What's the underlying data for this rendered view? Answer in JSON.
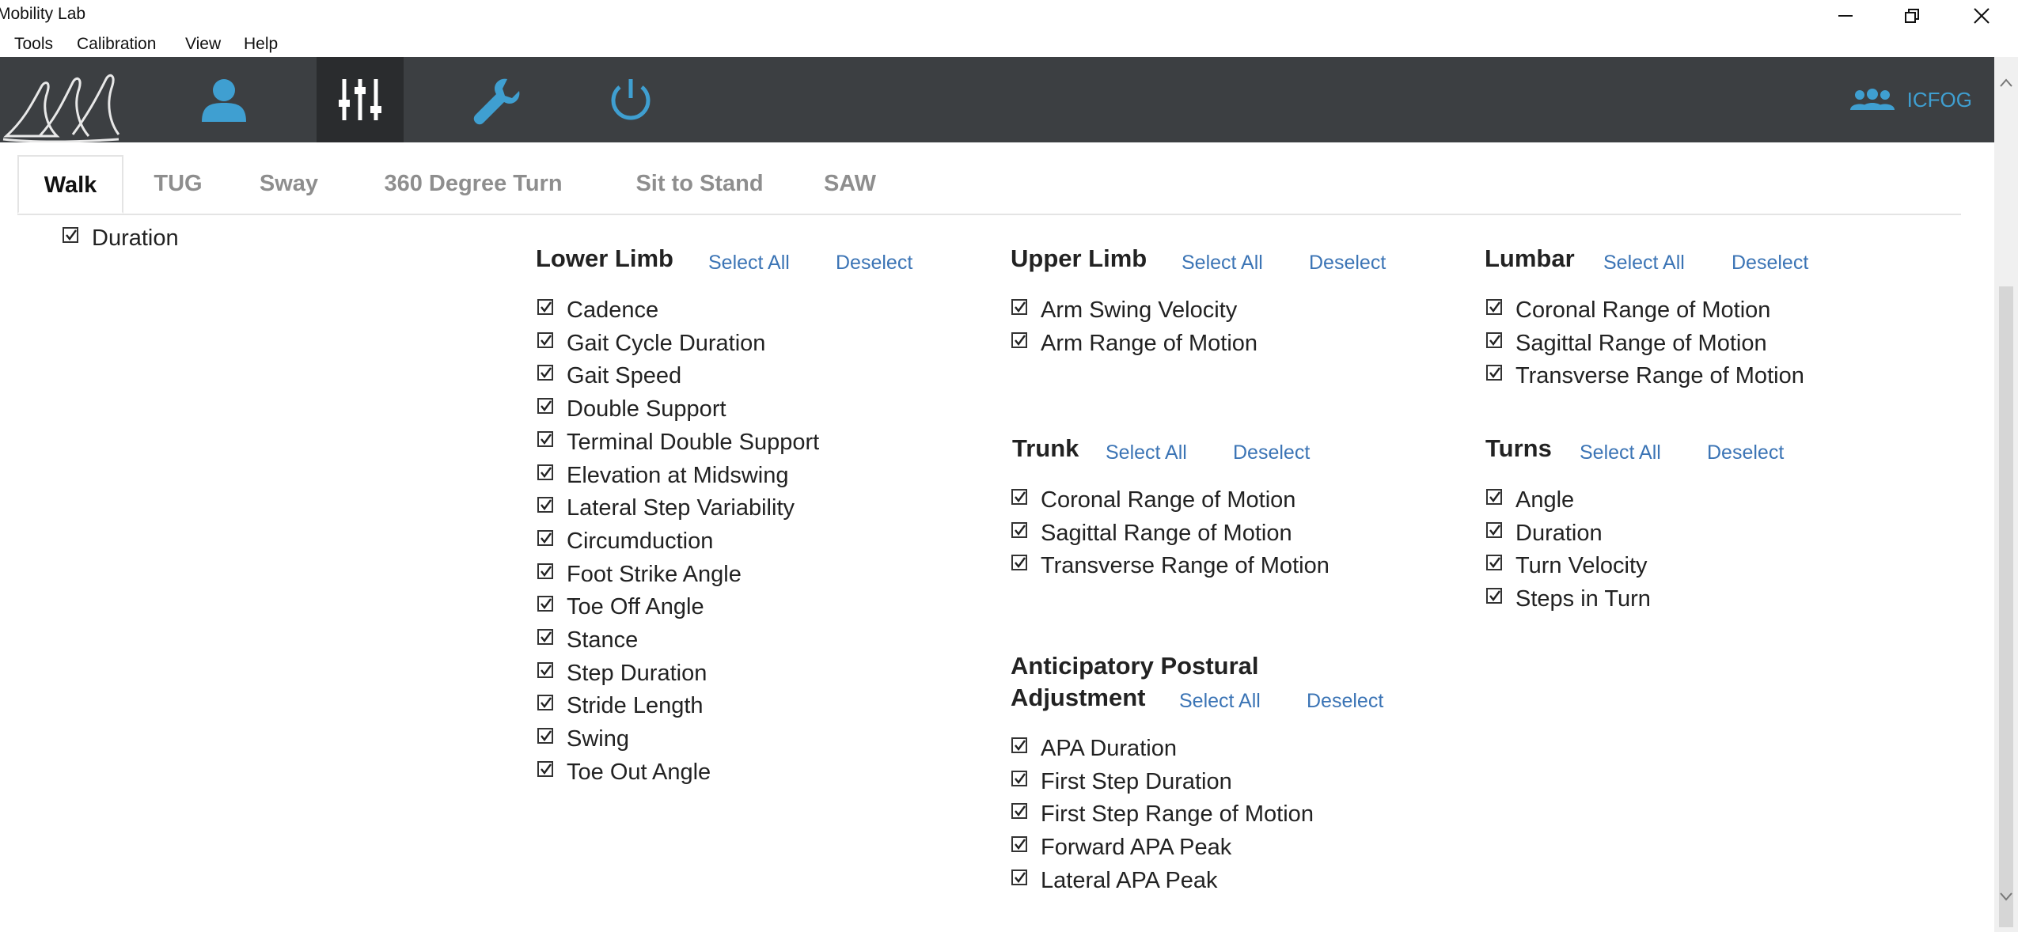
{
  "app": {
    "title": "Mobility Lab"
  },
  "menu": [
    "Tools",
    "Calibration",
    "View",
    "Help"
  ],
  "toolbar": {
    "user": "ICFOG"
  },
  "tabs": [
    "Walk",
    "TUG",
    "Sway",
    "360 Degree Turn",
    "Sit to Stand",
    "SAW"
  ],
  "duration_label": "Duration",
  "links": {
    "select_all": "Select All",
    "deselect": "Deselect"
  },
  "groups": {
    "lower_limb": {
      "title": "Lower Limb",
      "items": [
        "Cadence",
        "Gait Cycle Duration",
        "Gait Speed",
        "Double Support",
        "Terminal Double Support",
        "Elevation at Midswing",
        "Lateral Step Variability",
        "Circumduction",
        "Foot Strike Angle",
        "Toe Off Angle",
        "Stance",
        "Step Duration",
        "Stride Length",
        "Swing",
        "Toe Out Angle"
      ]
    },
    "upper_limb": {
      "title": "Upper Limb",
      "items": [
        "Arm Swing Velocity",
        "Arm Range of Motion"
      ]
    },
    "trunk": {
      "title": "Trunk",
      "items": [
        "Coronal Range of Motion",
        "Sagittal Range of Motion",
        "Transverse Range of Motion"
      ]
    },
    "apa": {
      "title_line1": "Anticipatory Postural",
      "title_line2": "Adjustment",
      "items": [
        "APA Duration",
        "First Step Duration",
        "First Step Range of Motion",
        "Forward APA Peak",
        "Lateral APA Peak"
      ]
    },
    "lumbar": {
      "title": "Lumbar",
      "items": [
        "Coronal Range of Motion",
        "Sagittal Range of Motion",
        "Transverse Range of Motion"
      ]
    },
    "turns": {
      "title": "Turns",
      "items": [
        "Angle",
        "Duration",
        "Turn Velocity",
        "Steps in Turn"
      ]
    }
  },
  "colors": {
    "toolbar": "#3c3f42",
    "accent": "#3f9fd1",
    "link": "#3b74b5"
  }
}
